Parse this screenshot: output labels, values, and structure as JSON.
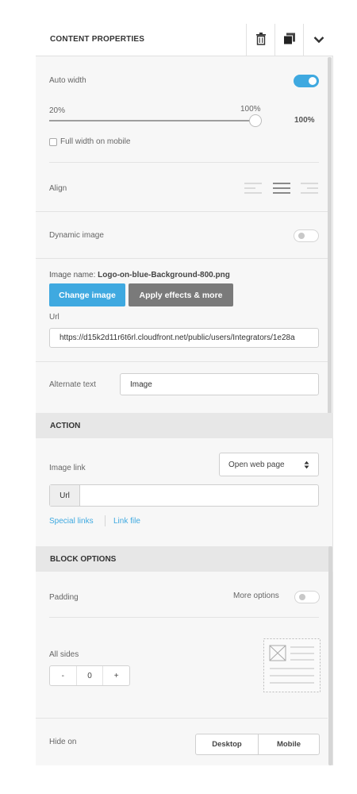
{
  "header": {
    "title": "CONTENT PROPERTIES",
    "icons": [
      "trash-icon",
      "duplicate-icon",
      "chevron-down-icon"
    ]
  },
  "content": {
    "auto_width_label": "Auto width",
    "auto_width_on": true,
    "slider_min_label": "20%",
    "slider_max_label": "100%",
    "slider_value_label": "100%",
    "slider_value_fraction": 1.0,
    "full_width_mobile_label": "Full width on mobile",
    "full_width_mobile_checked": false,
    "align_label": "Align",
    "align_selected": "center",
    "dynamic_image_label": "Dynamic image",
    "dynamic_image_on": false,
    "image_name_prefix": "Image name:",
    "image_name_value": "Logo-on-blue-Background-800.png",
    "change_image_label": "Change image",
    "apply_effects_label": "Apply effects & more",
    "url_label": "Url",
    "url_value": "https://d15k2d11r6t6rl.cloudfront.net/public/users/Integrators/1e28a",
    "alt_text_label": "Alternate text",
    "alt_text_value": "Image"
  },
  "action": {
    "section_title": "ACTION",
    "image_link_label": "Image link",
    "select_value": "Open web page",
    "url_prefix": "Url",
    "url_value": "",
    "special_links_label": "Special links",
    "link_file_label": "Link file"
  },
  "block": {
    "section_title": "BLOCK OPTIONS",
    "padding_label": "Padding",
    "more_options_label": "More options",
    "more_options_on": false,
    "all_sides_label": "All sides",
    "stepper_minus": "-",
    "stepper_value": "0",
    "stepper_plus": "+",
    "hide_on_label": "Hide on",
    "hide_desktop_label": "Desktop",
    "hide_mobile_label": "Mobile"
  },
  "colors": {
    "accent": "#3fa9e0",
    "secondary_button": "#7a7a7a",
    "section_header_bg": "#e7e7e7",
    "panel_bg": "#f7f7f7"
  }
}
